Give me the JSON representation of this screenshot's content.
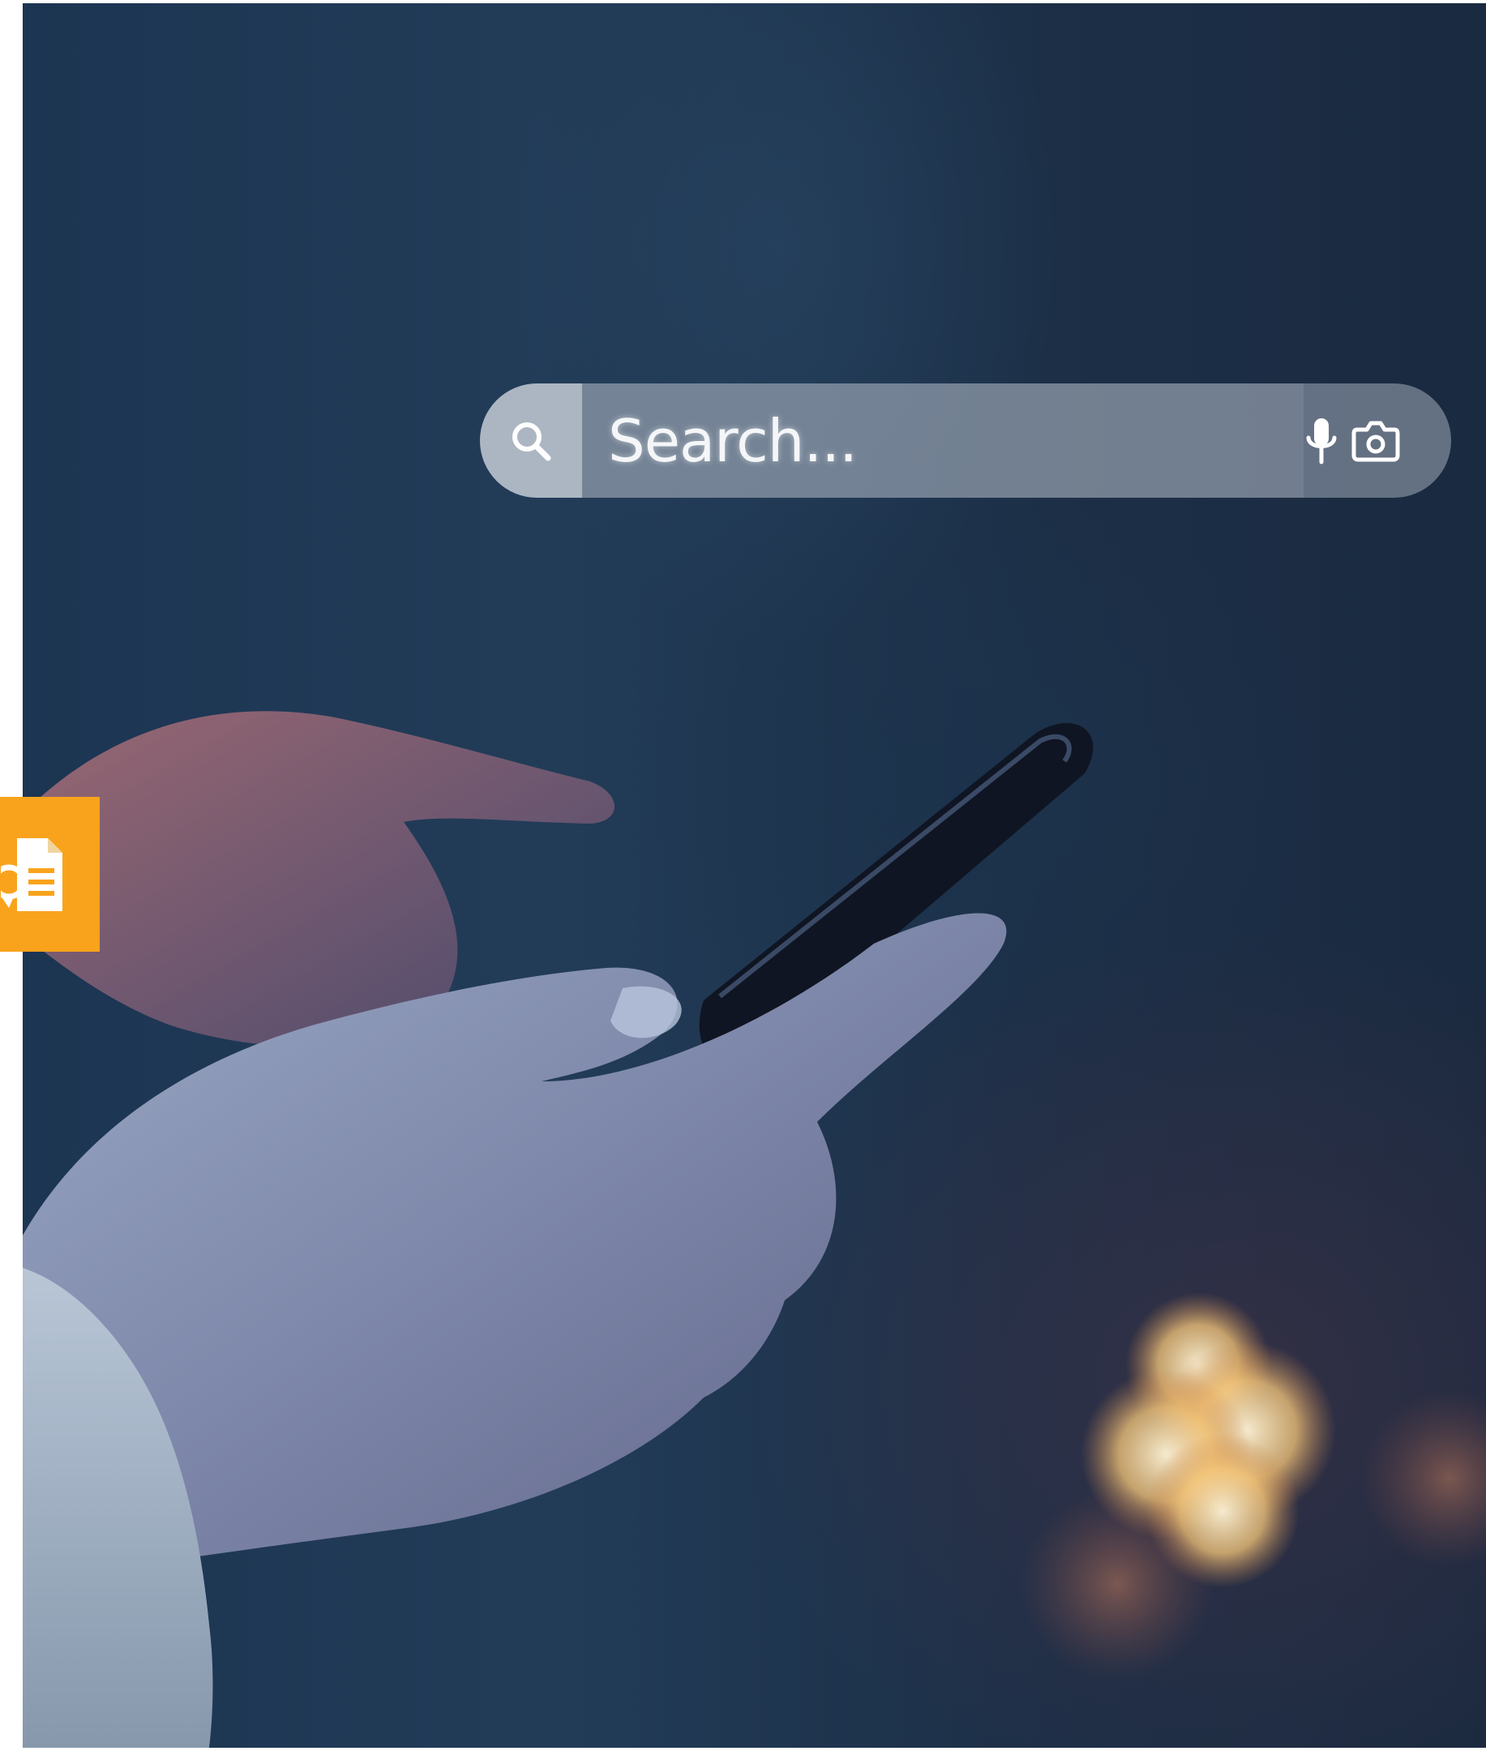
{
  "search": {
    "placeholder": "Search..."
  },
  "icons": {
    "search": "search-icon",
    "microphone": "microphone-icon",
    "camera": "camera-icon",
    "document": "document-speech-icon"
  },
  "colors": {
    "badge": "#f9a31c",
    "background": "#1f3753"
  }
}
